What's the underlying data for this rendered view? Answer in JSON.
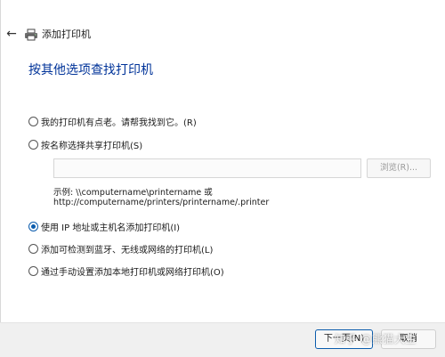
{
  "window": {
    "title": "添加打印机",
    "back_icon": "arrow-left-icon",
    "title_icon": "printer-icon"
  },
  "heading": "按其他选项查找打印机",
  "options": [
    {
      "label": "我的打印机有点老。请帮我找到它。(R)",
      "checked": false
    },
    {
      "label": "按名称选择共享打印机(S)",
      "checked": false
    },
    {
      "label": "使用 IP 地址或主机名添加打印机(I)",
      "checked": true
    },
    {
      "label": "添加可检测到蓝牙、无线或网络的打印机(L)",
      "checked": false
    },
    {
      "label": "通过手动设置添加本地打印机或网络打印机(O)",
      "checked": false
    }
  ],
  "share": {
    "input_value": "",
    "browse_label": "浏览(R)...",
    "example_line1": "示例: \\\\computername\\printername 或",
    "example_line2": "http://computername/printers/printername/.printer"
  },
  "footer": {
    "next_label": "下一页(N)",
    "cancel_label": "取消"
  },
  "watermark": "知乎 @熊猫大生",
  "colors": {
    "heading": "#003399",
    "accent": "#0b5cad"
  }
}
